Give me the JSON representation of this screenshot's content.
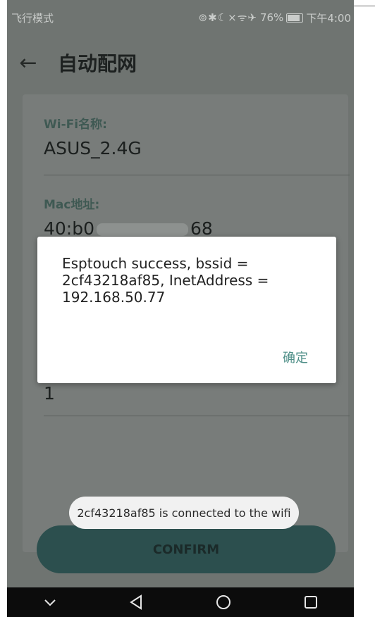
{
  "status_bar": {
    "mode": "飞行模式",
    "icons": "⊚✱☾⨯ᯤ✈",
    "battery": "76%",
    "time": "下午4:00"
  },
  "app_bar": {
    "back_glyph": "←",
    "title": "自动配网"
  },
  "form": {
    "wifi_label": "Wi-Fi名称:",
    "wifi_value": "ASUS_2.4G",
    "mac_label": "Mac地址:",
    "mac_value_start": "40:b0",
    "mac_value_end": "68",
    "count_value": "1"
  },
  "dialog": {
    "message": "Esptouch success, bssid = 2cf43218af85, InetAddress = 192.168.50.77",
    "ok_label": "确定"
  },
  "toast": {
    "text": "2cf43218af85 is connected to the wifi"
  },
  "confirm_button": {
    "label": "CONFIRM"
  },
  "nav_bar": {
    "icons": [
      "chevron-down-icon",
      "back-triangle-icon",
      "home-circle-icon",
      "recents-square-icon"
    ]
  },
  "colors": {
    "accent": "#4f8f88",
    "button": "#2c4f4e",
    "overlay": "#6f7471"
  }
}
